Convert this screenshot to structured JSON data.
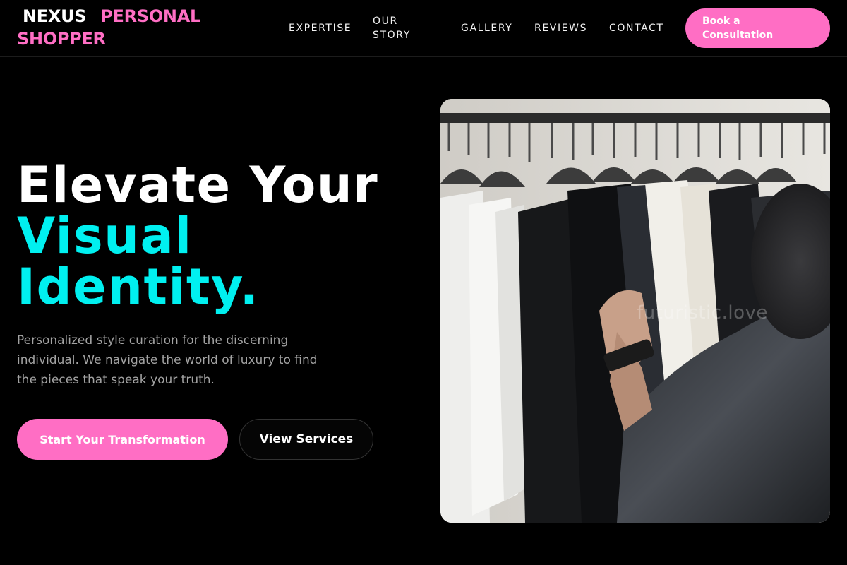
{
  "brand": {
    "word1": "NEXUS",
    "word2": "PERSONAL SHOPPER"
  },
  "nav": {
    "items": [
      {
        "label": "EXPERTISE"
      },
      {
        "label": "OUR STORY"
      },
      {
        "label": "GALLERY"
      },
      {
        "label": "REVIEWS"
      },
      {
        "label": "CONTACT"
      }
    ],
    "cta_label": "Book a Consultation"
  },
  "hero": {
    "title_line1": "Elevate Your",
    "title_line2": "Visual Identity.",
    "subtitle": "Personalized style curation for the discerning individual. We navigate the world of luxury to find the pieces that speak your truth.",
    "primary_button": "Start Your Transformation",
    "secondary_button": "View Services"
  },
  "image": {
    "watermark": "futuristic.love"
  },
  "colors": {
    "accent_pink": "#ff6ec4",
    "accent_cyan": "#00f0f0",
    "background": "#000000"
  }
}
